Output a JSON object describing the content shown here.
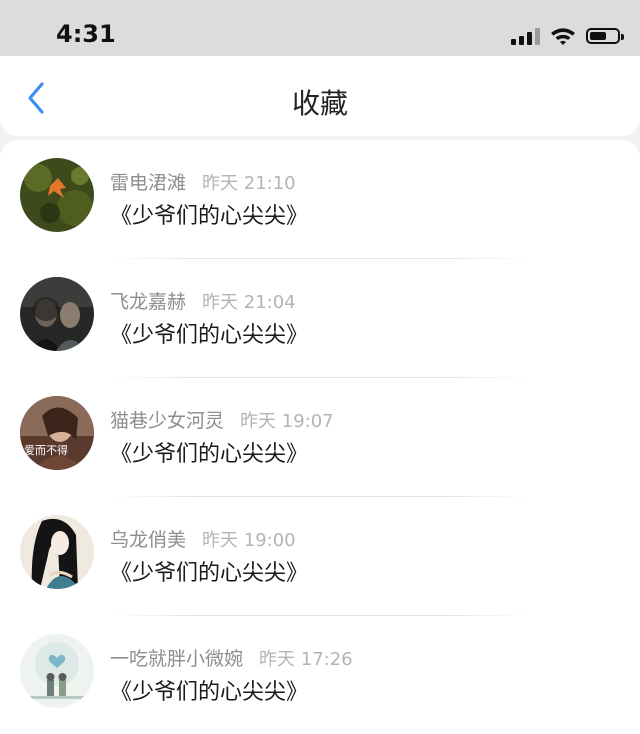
{
  "status_bar": {
    "time": "4:31",
    "icons": [
      "signal-icon",
      "wifi-icon",
      "battery-icon"
    ]
  },
  "nav": {
    "back_icon": "chevron-left-icon",
    "title": "收藏",
    "accent_color": "#3a8ef6"
  },
  "favorites": [
    {
      "name": "雷电涒滩",
      "time": "昨天 21:10",
      "title": "《少爷们的心尖尖》",
      "avatar": "avatar-autumn-leaf"
    },
    {
      "name": "飞龙嘉赫",
      "time": "昨天 21:04",
      "title": "《少爷们的心尖尖》",
      "avatar": "avatar-two-people"
    },
    {
      "name": "猫巷少女河灵",
      "time": "昨天 19:07",
      "title": "《少爷们的心尖尖》",
      "avatar": "avatar-girl-text",
      "avatar_text": "爱而不得"
    },
    {
      "name": "乌龙俏美",
      "time": "昨天 19:00",
      "title": "《少爷们的心尖尖》",
      "avatar": "avatar-illustrated-woman"
    },
    {
      "name": "一吃就胖小微婉",
      "time": "昨天 17:26",
      "title": "《少爷们的心尖尖》",
      "avatar": "avatar-couple-heart"
    }
  ]
}
